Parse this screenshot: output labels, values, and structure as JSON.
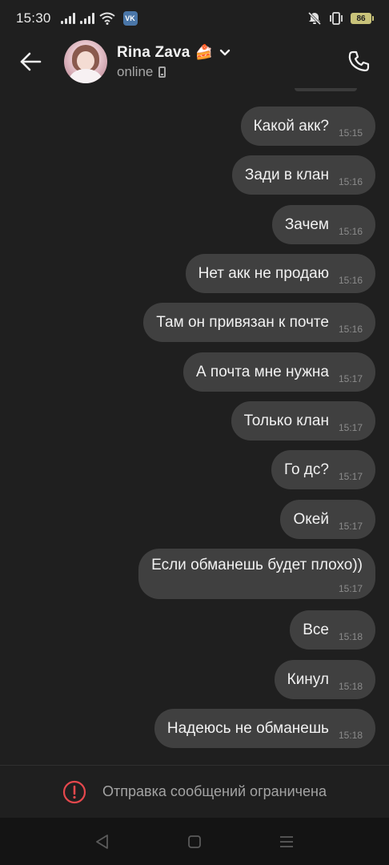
{
  "status_bar": {
    "time": "15:30",
    "vk_badge": "VK",
    "battery": "86"
  },
  "header": {
    "contact_name": "Rina Zava",
    "name_emoji": "🍰",
    "contact_status": "online"
  },
  "messages": [
    {
      "text": "Какой акк?",
      "time": "15:15"
    },
    {
      "text": "Зади в клан",
      "time": "15:16"
    },
    {
      "text": "Зачем",
      "time": "15:16"
    },
    {
      "text": "Нет акк не продаю",
      "time": "15:16"
    },
    {
      "text": "Там он привязан к почте",
      "time": "15:16"
    },
    {
      "text": "А почта мне нужна",
      "time": "15:17"
    },
    {
      "text": "Только клан",
      "time": "15:17"
    },
    {
      "text": "Го дс?",
      "time": "15:17"
    },
    {
      "text": "Окей",
      "time": "15:17"
    },
    {
      "text": "Если обманешь будет плохо))",
      "time": "15:17"
    },
    {
      "text": "Все",
      "time": "15:18"
    },
    {
      "text": "Кинул",
      "time": "15:18"
    },
    {
      "text": "Надеюсь не обманешь",
      "time": "15:18"
    }
  ],
  "restriction": {
    "text": "Отправка сообщений ограничена"
  },
  "colors": {
    "background": "#1f1f1f",
    "bubble": "#404040",
    "warning": "#e5484d",
    "navbar": "#141414"
  },
  "icons": {
    "back": "arrow-left-icon",
    "call": "phone-icon",
    "dropdown": "chevron-down-icon",
    "warning": "exclamation-circle-icon",
    "nav_back": "triangle-back-icon",
    "nav_home": "square-home-icon",
    "nav_menu": "menu-lines-icon"
  }
}
